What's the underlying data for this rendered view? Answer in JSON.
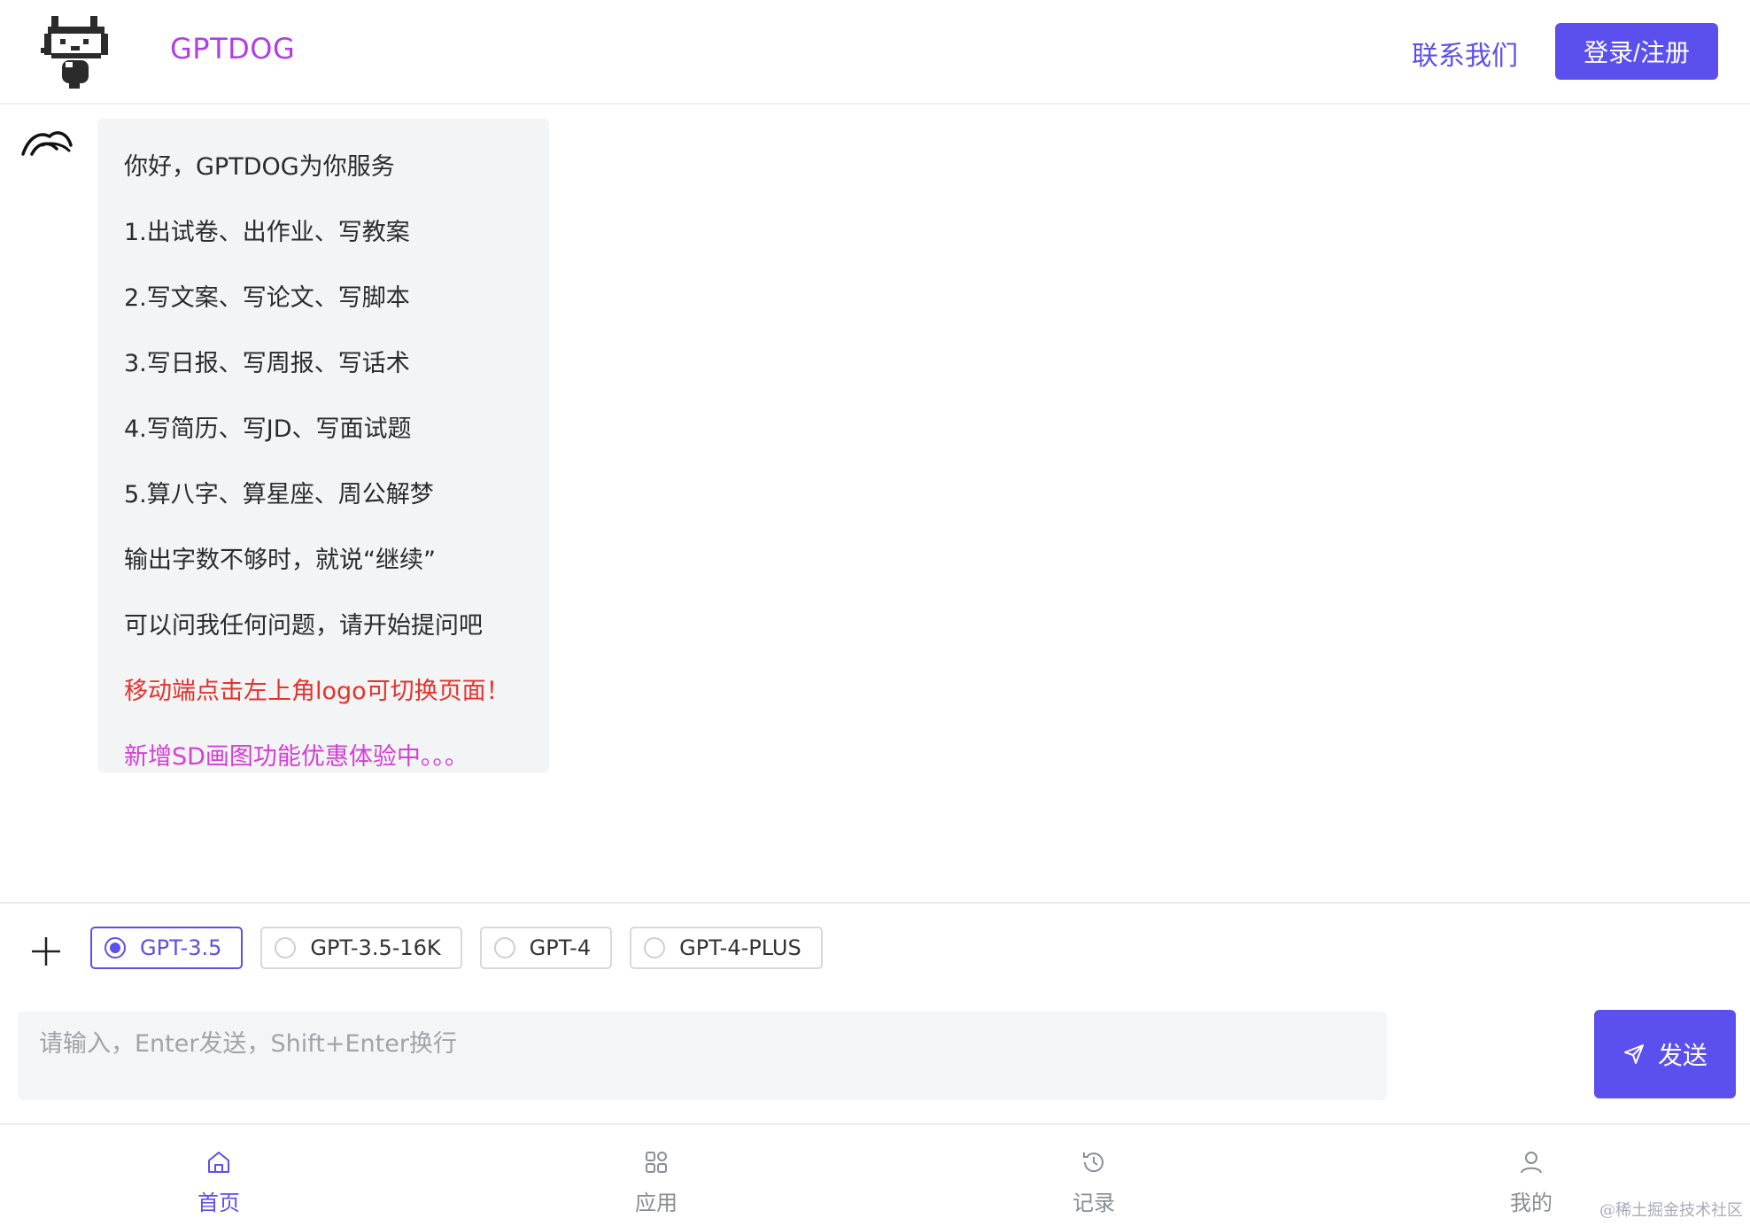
{
  "header": {
    "brand": "GPTDOG",
    "contact_label": "联系我们",
    "login_label": "登录/注册"
  },
  "chat": {
    "messages": [
      {
        "lines": [
          "你好，GPTDOG为你服务",
          "1.出试卷、出作业、写教案",
          "2.写文案、写论文、写脚本",
          "3.写日报、写周报、写话术",
          "4.写简历、写JD、写面试题",
          "5.算八字、算星座、周公解梦",
          "输出字数不够时，就说“继续”",
          "可以问我任何问题，请开始提问吧",
          "移动端点击左上角logo可切换页面！",
          "新增SD画图功能优惠体验中。。。"
        ],
        "highlight_colors": {
          "red": "#e5322b",
          "pink": "#d43fd6"
        }
      }
    ]
  },
  "composer": {
    "models": [
      {
        "label": "GPT-3.5",
        "selected": true
      },
      {
        "label": "GPT-3.5-16K",
        "selected": false
      },
      {
        "label": "GPT-4",
        "selected": false
      },
      {
        "label": "GPT-4-PLUS",
        "selected": false
      }
    ],
    "input_placeholder": "请输入，Enter发送，Shift+Enter换行",
    "input_value": "",
    "send_label": "发送"
  },
  "nav": {
    "items": [
      {
        "label": "首页",
        "icon": "home-icon",
        "active": true
      },
      {
        "label": "应用",
        "icon": "apps-icon",
        "active": false
      },
      {
        "label": "记录",
        "icon": "history-icon",
        "active": false
      },
      {
        "label": "我的",
        "icon": "user-icon",
        "active": false
      }
    ]
  },
  "watermark": "@稀土掘金技术社区",
  "colors": {
    "accent": "#5b50ee",
    "brand": "#b13ee6"
  }
}
